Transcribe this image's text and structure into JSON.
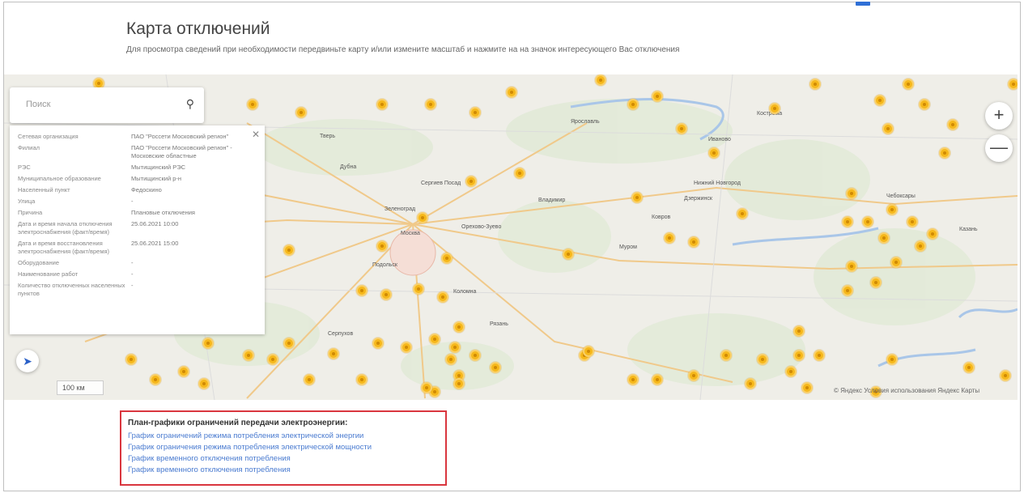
{
  "page": {
    "title": "Карта отключений",
    "subtitle": "Для просмотра сведений при необходимости передвиньте карту и/или измените масштаб и нажмите на на значок интересующего Вас отключения"
  },
  "search": {
    "placeholder": "Поиск"
  },
  "info_panel": {
    "rows": [
      {
        "k": "Сетевая организация",
        "v": "ПАО \"Россети Московский регион\""
      },
      {
        "k": "Филиал",
        "v": "ПАО \"Россети Московский регион\" - Московские областные"
      },
      {
        "k": "РЭС",
        "v": "Мытищинский РЭС"
      },
      {
        "k": "Муниципальное образование",
        "v": "Мытищинский р-н"
      },
      {
        "k": "Населенный пункт",
        "v": "Федоскино"
      },
      {
        "k": "Улица",
        "v": "-"
      },
      {
        "k": "Причина",
        "v": "Плановые отключения"
      },
      {
        "k": "Дата и время начала отключения электроснабжения (факт/время)",
        "v": "25.06.2021 10:00"
      },
      {
        "k": "Дата и время восстановления электроснабжения (факт/время)",
        "v": "25.06.2021 15:00"
      },
      {
        "k": "Оборудование",
        "v": "-"
      },
      {
        "k": "Наименование работ",
        "v": "-"
      },
      {
        "k": "Количество отключенных населенных пунктов",
        "v": "-"
      }
    ]
  },
  "map": {
    "zoom_in": "+",
    "zoom_out": "—",
    "scale": "100 км",
    "attribution": "© Яндекс Условия использования Яндекс Карты",
    "labels": {
      "moscow": "Москва",
      "zelenograd": "Зеленоград",
      "nizhny": "Нижний Новгород",
      "vladimir": "Владимир",
      "kostroma": "Кострома",
      "tver": "Тверь",
      "yaroslavl": "Ярославль",
      "ivanovo": "Иваново",
      "kovrov": "Ковров",
      "murom": "Муром",
      "ryazan": "Рязань",
      "dzerzhinsk": "Дзержинск",
      "cheboksary": "Чебоксары",
      "kazan": "Казань",
      "serpukhov": "Серпухов",
      "podolsk": "Подольск",
      "orehovo": "Орехово-Зуево",
      "sergiev": "Сергиев Посад",
      "dubna": "Дубна",
      "kolomna": "Коломна"
    }
  },
  "plans": {
    "heading": "План-графики ограничений передачи электроэнергии:",
    "links": [
      "График ограничений режима потребления электрической энергии",
      "График ограничения режима потребления электрической мощности",
      "График временного отключения потребления",
      "График временного отключения потребления"
    ]
  }
}
